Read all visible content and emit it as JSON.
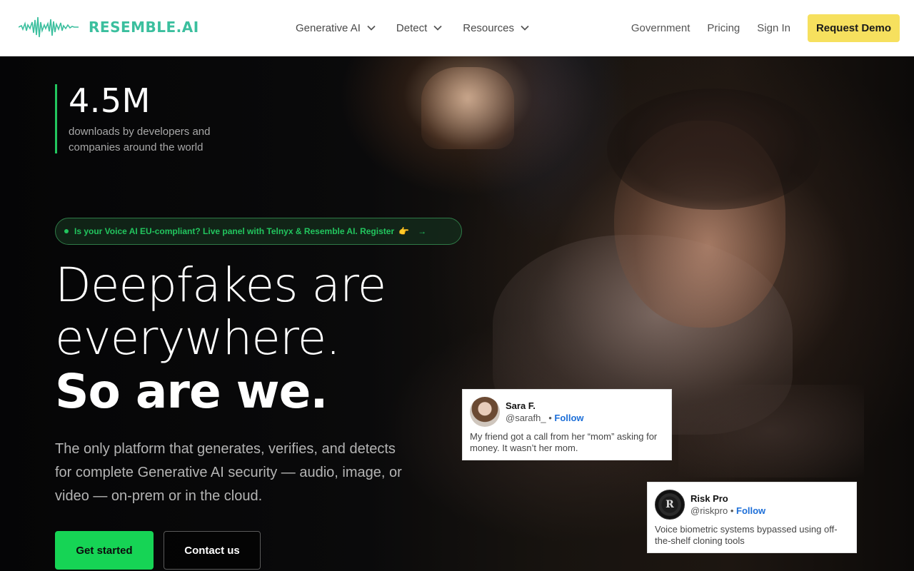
{
  "brand": {
    "name": "RESEMBLE.AI",
    "accent": "#3bbf9e"
  },
  "nav": {
    "menus": [
      {
        "label": "Generative AI",
        "icon": "chevron-down-icon"
      },
      {
        "label": "Detect",
        "icon": "chevron-down-icon"
      },
      {
        "label": "Resources",
        "icon": "chevron-down-icon"
      }
    ],
    "links": [
      "Government",
      "Pricing",
      "Sign In"
    ],
    "cta": "Request Demo",
    "cta_color": "#f6e05e"
  },
  "stat": {
    "value": "4.5M",
    "description": "downloads by developers and companies around the world"
  },
  "banner": {
    "text": "Is your Voice AI EU-compliant? Live panel with Telnyx & Resemble AI. Register",
    "emoji": "👉",
    "arrow": "→"
  },
  "hero": {
    "headline_line1": "Deepfakes are",
    "headline_line2": "everywhere.",
    "headline_bold": "So are we.",
    "subtitle": "The only platform that generates, verifies, and detects for complete Generative AI security — audio, image, or video — on-prem or in the cloud.",
    "primary_cta": "Get started",
    "secondary_cta": "Contact us",
    "primary_color": "#16d455"
  },
  "cards": [
    {
      "name": "Sara F.",
      "handle": "@sarafh_",
      "separator": "•",
      "follow": "Follow",
      "text": "My friend got a call from her “mom” asking for money. It wasn’t her mom."
    },
    {
      "name": "Risk Pro",
      "handle": "@riskpro",
      "separator": "•",
      "follow": "Follow",
      "text": "Voice biometric systems bypassed using off-the-shelf cloning tools",
      "avatar_letter": "R"
    }
  ]
}
